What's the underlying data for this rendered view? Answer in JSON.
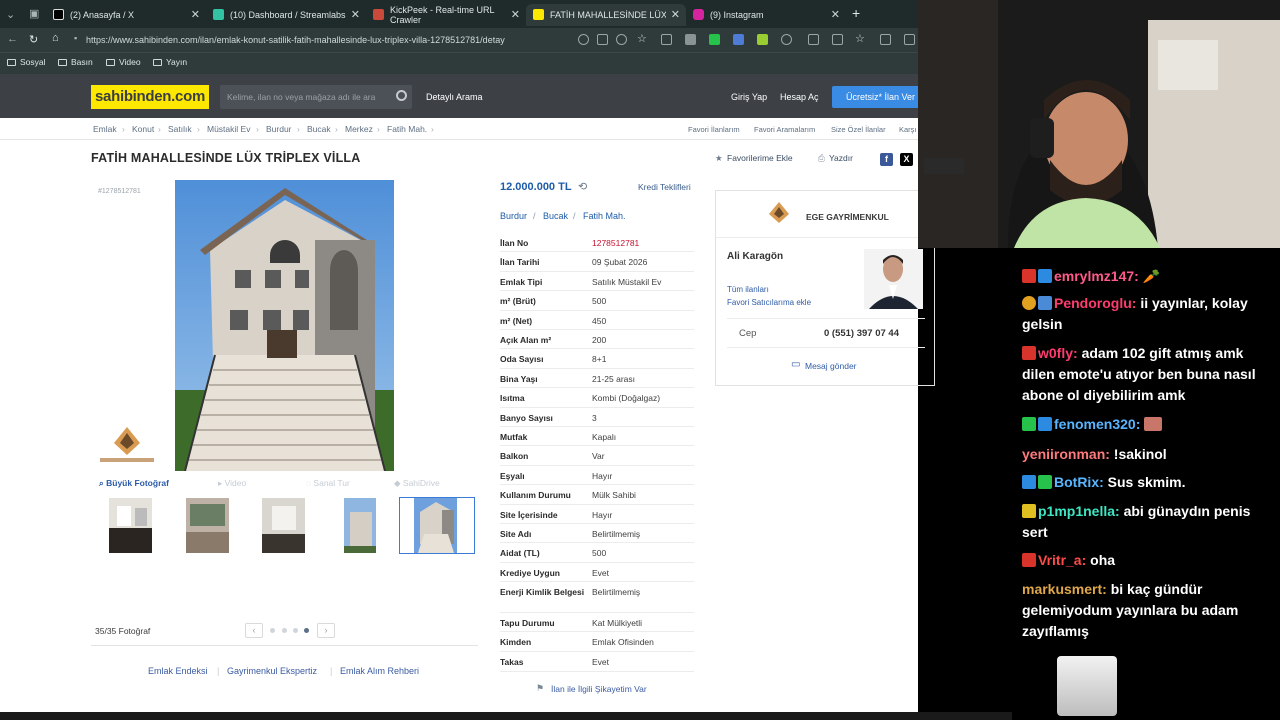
{
  "browser": {
    "tabs": [
      {
        "title": "(2) Anasayfa / X",
        "close": "✕"
      },
      {
        "title": "(10) Dashboard / Streamlabs",
        "close": "✕"
      },
      {
        "title": "KickPeek - Real-time URL Crawler",
        "close": "✕"
      },
      {
        "title": "FATİH MAHALLESİNDE LÜX TRİPLE",
        "close": "✕"
      },
      {
        "title": "(9) Instagram",
        "close": "✕"
      }
    ],
    "new_tab": "+",
    "url": "https://www.sahibinden.com/ilan/emlak-konut-satilik-fatih-mahallesinde-lux-triplex-villa-1278512781/detay",
    "bookmarks": [
      "Sosyal",
      "Basın",
      "Video",
      "Yayın"
    ]
  },
  "site": {
    "logo": "sahibinden.com",
    "search_placeholder": "Kelime, ilan no veya mağaza adı ile ara",
    "detailed_search": "Detaylı Arama",
    "login": "Giriş Yap",
    "register": "Hesap Aç",
    "cta": "Ücretsiz* İlan Ver",
    "breadcrumbs": [
      "Emlak",
      "Konut",
      "Satılık",
      "Müstakil Ev",
      "Burdur",
      "Bucak",
      "Merkez",
      "Fatih Mah."
    ],
    "crumb_sep": "›",
    "right_links": [
      "Favori İlanlarım",
      "Favori Aramalarım",
      "Size Özel İlanlar",
      "Karşı"
    ],
    "title": "FATİH MAHALLESİNDE LÜX TRİPLEX VİLLA",
    "favorite": "Favorilerime Ekle",
    "print": "Yazdır",
    "listing_id": "#1278512781",
    "photo_tabs": [
      "Büyük Fotoğraf",
      "Video",
      "Sanal Tur",
      "SahiDrive"
    ],
    "photo_count": "35/35 Fotoğraf",
    "price": "12.000.000 TL",
    "credit": "Kredi Teklifleri",
    "location": [
      "Burdur",
      "Bucak",
      "Fatih Mah."
    ],
    "location_sep": "/",
    "specs": [
      {
        "k": "İlan No",
        "v": "1278512781"
      },
      {
        "k": "İlan Tarihi",
        "v": "09 Şubat 2026"
      },
      {
        "k": "Emlak Tipi",
        "v": "Satılık Müstakil Ev"
      },
      {
        "k": "m² (Brüt)",
        "v": "500"
      },
      {
        "k": "m² (Net)",
        "v": "450"
      },
      {
        "k": "Açık Alan m²",
        "v": "200"
      },
      {
        "k": "Oda Sayısı",
        "v": "8+1"
      },
      {
        "k": "Bina Yaşı",
        "v": "21-25 arası"
      },
      {
        "k": "Isıtma",
        "v": "Kombi (Doğalgaz)"
      },
      {
        "k": "Banyo Sayısı",
        "v": "3"
      },
      {
        "k": "Mutfak",
        "v": "Kapalı"
      },
      {
        "k": "Balkon",
        "v": "Var"
      },
      {
        "k": "Eşyalı",
        "v": "Hayır"
      },
      {
        "k": "Kullanım Durumu",
        "v": "Mülk Sahibi"
      },
      {
        "k": "Site İçerisinde",
        "v": "Hayır"
      },
      {
        "k": "Site Adı",
        "v": "Belirtilmemiş"
      },
      {
        "k": "Aidat (TL)",
        "v": "500"
      },
      {
        "k": "Krediye Uygun",
        "v": "Evet"
      },
      {
        "k": "Enerji Kimlik Belgesi",
        "v": "Belirtilmemiş"
      },
      {
        "k": "Tapu Durumu",
        "v": "Kat Mülkiyetli"
      },
      {
        "k": "Kimden",
        "v": "Emlak Ofisinden"
      },
      {
        "k": "Takas",
        "v": "Evet"
      }
    ],
    "complaint": "İlan ile İlgili Şikayetim Var",
    "footer_links": [
      "Emlak Endeksi",
      "Gayrimenkul Ekspertiz",
      "Emlak Alım Rehberi"
    ],
    "agency": {
      "name": "EGE GAYRİMENKUL",
      "agent": "Ali Karagön",
      "all_listings": "Tüm ilanları",
      "fav_seller": "Favori Satıcılarıma ekle",
      "phone_label": "Cep",
      "phone": "0 (551) 397 07 44",
      "message": "Mesaj gönder"
    }
  },
  "chat": [
    {
      "user": "emrylmz147:",
      "text": "",
      "color": "#ff5a8a"
    },
    {
      "user": "Pendoroglu:",
      "text": "ii yayınlar, kolay gelsin",
      "color": "#ff3c6e"
    },
    {
      "user": "w0fly:",
      "text": "adam 102 gift atmış amk dilen emote'u atıyor ben buna nasıl abone ol diyebilirim amk",
      "color": "#ff3c6e"
    },
    {
      "user": "fenomen320:",
      "text": "",
      "color": "#5ab4ff"
    },
    {
      "user": "yeniironman:",
      "text": "!sakinol",
      "color": "#ff7a7a"
    },
    {
      "user": "BotRix:",
      "text": "Sus skmim.",
      "color": "#59b7ff"
    },
    {
      "user": "p1mp1nella:",
      "text": "abi günaydın penis sert",
      "color": "#3ee6c4"
    },
    {
      "user": "Vritr_a:",
      "text": "oha",
      "color": "#ff4a4a"
    },
    {
      "user": "markusmert:",
      "text": "bi kaç gündür gelemiyodum yayınlara bu adam zayıflamış",
      "color": "#e0a84a"
    }
  ]
}
